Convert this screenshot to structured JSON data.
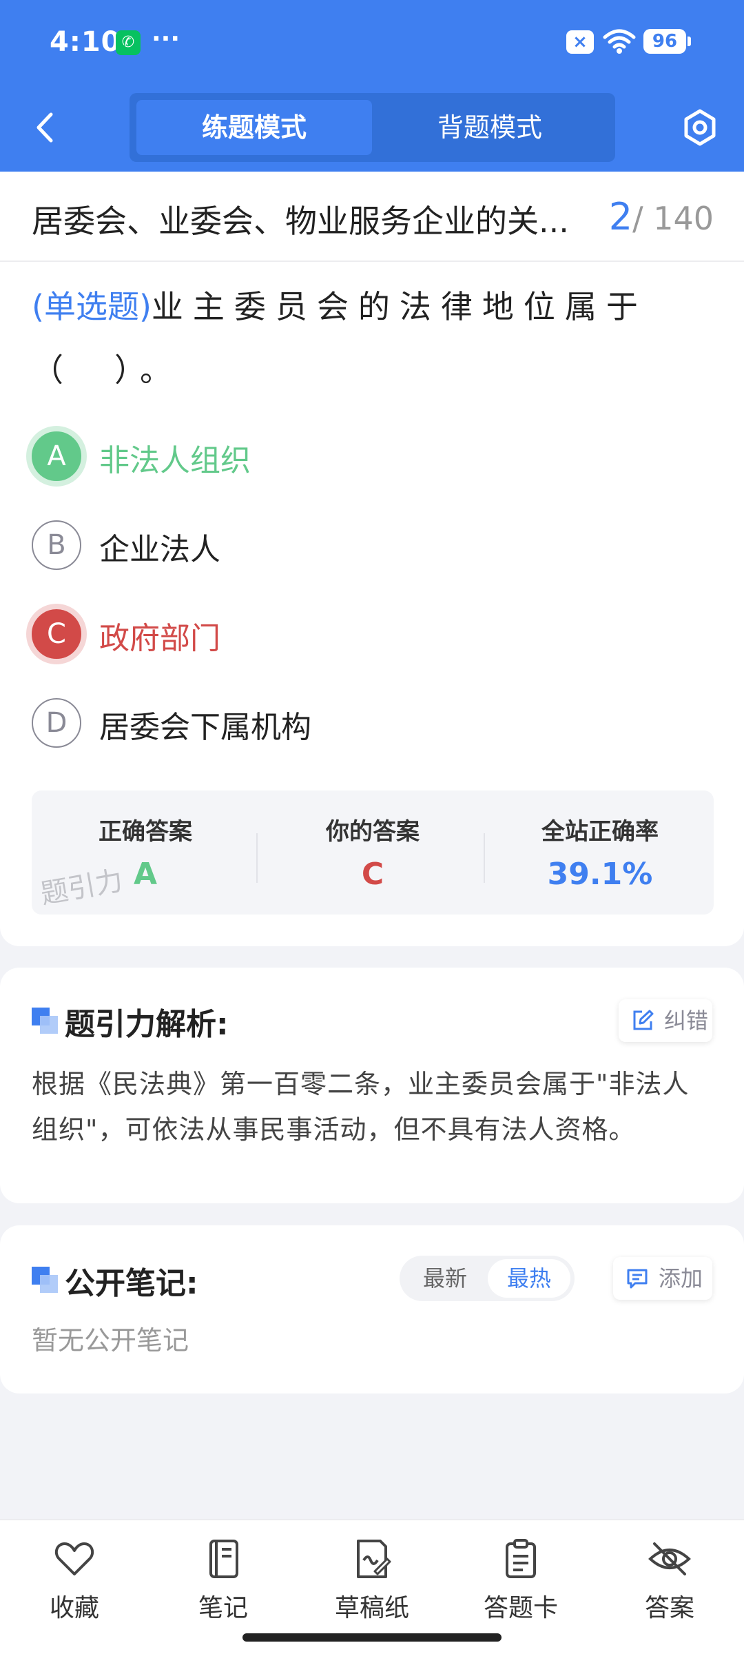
{
  "status_bar": {
    "time": "4:10",
    "more": "···",
    "battery": "96"
  },
  "nav": {
    "tabs": [
      {
        "label": "练题模式",
        "active": true
      },
      {
        "label": "背题模式",
        "active": false
      }
    ]
  },
  "question": {
    "chapter_title": "居委会、业委会、物业服务企业的关...",
    "current": "2",
    "total": "/ 140",
    "type_label": "(单选题)",
    "text": "业主委员会的法律地位属于（　）。",
    "options": [
      {
        "letter": "A",
        "text": "非法人组织",
        "state": "correct"
      },
      {
        "letter": "B",
        "text": "企业法人",
        "state": "normal"
      },
      {
        "letter": "C",
        "text": "政府部门",
        "state": "wrong"
      },
      {
        "letter": "D",
        "text": "居委会下属机构",
        "state": "normal"
      }
    ]
  },
  "stats": {
    "correct_label": "正确答案",
    "correct_value": "A",
    "yours_label": "你的答案",
    "yours_value": "C",
    "rate_label": "全站正确率",
    "rate_value": "39.1%",
    "watermark": "题引力"
  },
  "analysis": {
    "title": "题引力解析:",
    "report_label": "纠错",
    "text": "根据《民法典》第一百零二条，业主委员会属于\"非法人组织\"，可依法从事民事活动，但不具有法人资格。"
  },
  "notes": {
    "title": "公开笔记:",
    "sort_latest": "最新",
    "sort_hot": "最热",
    "add_label": "添加",
    "empty_text": "暂无公开笔记"
  },
  "toolbar": {
    "items": [
      {
        "label": "收藏",
        "icon": "heart-icon"
      },
      {
        "label": "笔记",
        "icon": "notebook-icon"
      },
      {
        "label": "草稿纸",
        "icon": "draft-icon"
      },
      {
        "label": "答题卡",
        "icon": "clipboard-icon"
      },
      {
        "label": "答案",
        "icon": "eye-off-icon"
      }
    ]
  },
  "colors": {
    "primary": "#3f7ff0",
    "correct": "#62c98a",
    "wrong": "#d24a48"
  }
}
